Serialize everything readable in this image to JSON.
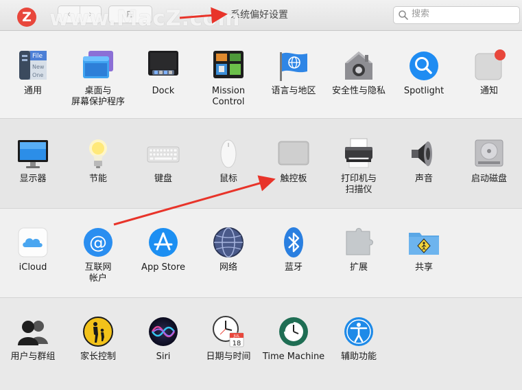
{
  "window": {
    "title": "系统偏好设置",
    "nav_back": "‹",
    "nav_forward": "›",
    "grid_button": "⊞"
  },
  "watermark": {
    "badge": "Z",
    "text": "www.MacZ.com"
  },
  "search": {
    "placeholder": "搜索",
    "value": ""
  },
  "sections": [
    {
      "items": [
        {
          "label": "通用",
          "icon": "general-icon"
        },
        {
          "label": "桌面与\n屏幕保护程序",
          "icon": "desktop-screensaver-icon"
        },
        {
          "label": "Dock",
          "icon": "dock-icon"
        },
        {
          "label": "Mission\nControl",
          "icon": "mission-control-icon"
        },
        {
          "label": "语言与地区",
          "icon": "language-region-icon"
        },
        {
          "label": "安全性与隐私",
          "icon": "security-privacy-icon"
        },
        {
          "label": "Spotlight",
          "icon": "spotlight-icon"
        },
        {
          "label": "通知",
          "icon": "notifications-icon"
        }
      ]
    },
    {
      "items": [
        {
          "label": "显示器",
          "icon": "displays-icon"
        },
        {
          "label": "节能",
          "icon": "energy-saver-icon"
        },
        {
          "label": "键盘",
          "icon": "keyboard-icon"
        },
        {
          "label": "鼠标",
          "icon": "mouse-icon"
        },
        {
          "label": "触控板",
          "icon": "trackpad-icon"
        },
        {
          "label": "打印机与\n扫描仪",
          "icon": "printers-scanners-icon"
        },
        {
          "label": "声音",
          "icon": "sound-icon"
        },
        {
          "label": "启动磁盘",
          "icon": "startup-disk-icon"
        }
      ]
    },
    {
      "items": [
        {
          "label": "iCloud",
          "icon": "icloud-icon"
        },
        {
          "label": "互联网\n帐户",
          "icon": "internet-accounts-icon"
        },
        {
          "label": "App Store",
          "icon": "app-store-icon"
        },
        {
          "label": "网络",
          "icon": "network-icon"
        },
        {
          "label": "蓝牙",
          "icon": "bluetooth-icon"
        },
        {
          "label": "扩展",
          "icon": "extensions-icon"
        },
        {
          "label": "共享",
          "icon": "sharing-icon"
        }
      ]
    },
    {
      "items": [
        {
          "label": "用户与群组",
          "icon": "users-groups-icon"
        },
        {
          "label": "家长控制",
          "icon": "parental-controls-icon"
        },
        {
          "label": "Siri",
          "icon": "siri-icon"
        },
        {
          "label": "日期与时间",
          "icon": "date-time-icon"
        },
        {
          "label": "Time Machine",
          "icon": "time-machine-icon"
        },
        {
          "label": "辅助功能",
          "icon": "accessibility-icon"
        }
      ]
    }
  ],
  "icon_text": {
    "general_file": "File",
    "general_new": "New",
    "general_one": "One",
    "calendar_month": "JUL",
    "calendar_day": "18"
  },
  "colors": {
    "annotation_arrow": "#e8342a",
    "badge_red": "#e8473c",
    "accent_blue": "#1f8cf2"
  }
}
